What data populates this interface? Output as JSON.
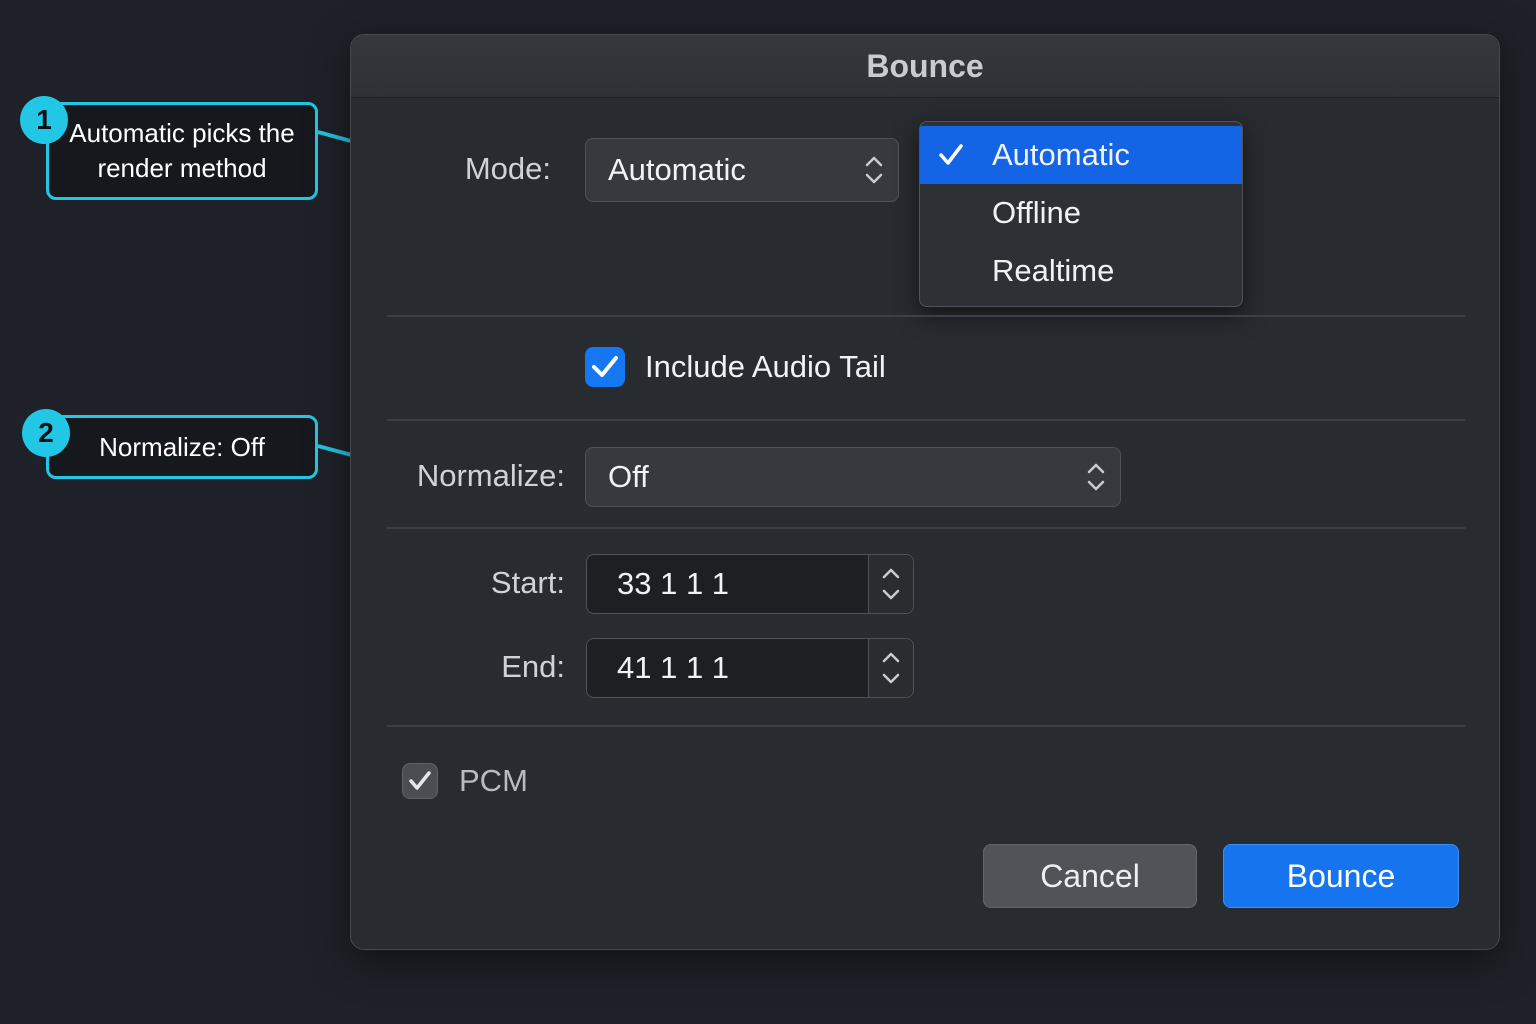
{
  "dialog": {
    "title": "Bounce",
    "mode": {
      "label": "Mode:",
      "value": "Automatic",
      "menu_options": [
        {
          "label": "Automatic",
          "selected": true
        },
        {
          "label": "Offline",
          "selected": false
        },
        {
          "label": "Realtime",
          "selected": false
        }
      ]
    },
    "include_audio_tail": {
      "label": "Include Audio Tail",
      "checked": true
    },
    "normalize": {
      "label": "Normalize:",
      "value": "Off"
    },
    "start": {
      "label": "Start:",
      "value": "33 1 1 1"
    },
    "end": {
      "label": "End:",
      "value": "41 1 1 1"
    },
    "pcm": {
      "label": "PCM",
      "checked": true
    },
    "buttons": {
      "cancel": "Cancel",
      "bounce": "Bounce"
    }
  },
  "annotations": [
    {
      "number": "1",
      "text": "Automatic picks the render method"
    },
    {
      "number": "2",
      "text": "Normalize: Off"
    }
  ],
  "colors": {
    "background": "#1e2228",
    "dialog": "#282b30",
    "accent_blue": "#1574ee",
    "callout_cyan": "#22c7e6"
  }
}
